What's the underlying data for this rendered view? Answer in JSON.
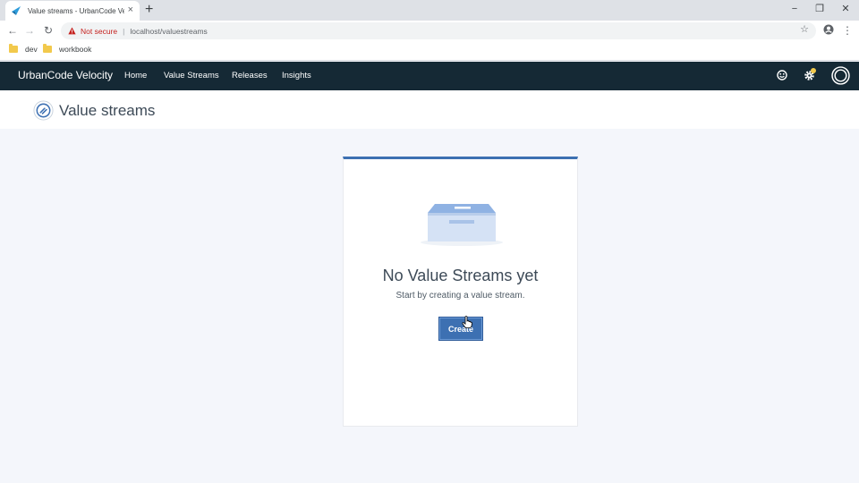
{
  "browser": {
    "tab_title": "Value streams - UrbanCode Velocity",
    "tab_close": "×",
    "new_tab": "+",
    "window_controls": {
      "minimize": "−",
      "restore": "❐",
      "close": "✕"
    },
    "nav": {
      "back": "←",
      "forward": "→",
      "reload": "↻"
    },
    "security_label": "Not secure",
    "separator": "|",
    "url": "localhost/valuestreams",
    "bookmark_star": "☆",
    "menu": "⋮",
    "bookmarks": [
      {
        "label": "dev"
      },
      {
        "label": "workbook"
      }
    ]
  },
  "app": {
    "brand": "UrbanCode Velocity",
    "nav": [
      "Home",
      "Value Streams",
      "Releases",
      "Insights"
    ],
    "icons": [
      "smiley-icon",
      "settings-icon",
      "user-profile-icon"
    ],
    "notification_dot_color": "#f2c94c",
    "header_bg": "#152935",
    "accent": "#3d70b2"
  },
  "page": {
    "title": "Value streams",
    "empty_state": {
      "title": "No Value Streams yet",
      "subtitle": "Start by creating a value stream.",
      "button": "Create"
    }
  }
}
